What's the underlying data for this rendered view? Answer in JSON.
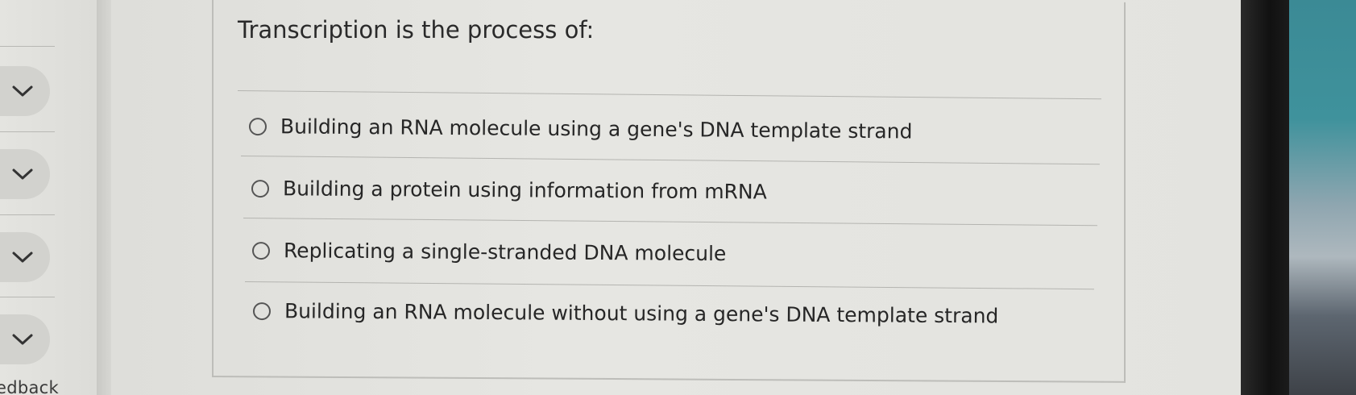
{
  "nav": {
    "feedback_label": "edback"
  },
  "question": {
    "text": "Transcription is the process of:",
    "options": [
      {
        "label": "Building an RNA molecule using a gene's DNA template strand",
        "selected": false
      },
      {
        "label": "Building a protein using information from mRNA",
        "selected": false
      },
      {
        "label": "Replicating a single-stranded DNA molecule",
        "selected": false
      },
      {
        "label": "Building an RNA molecule without using a gene's DNA template strand",
        "selected": false
      }
    ]
  }
}
